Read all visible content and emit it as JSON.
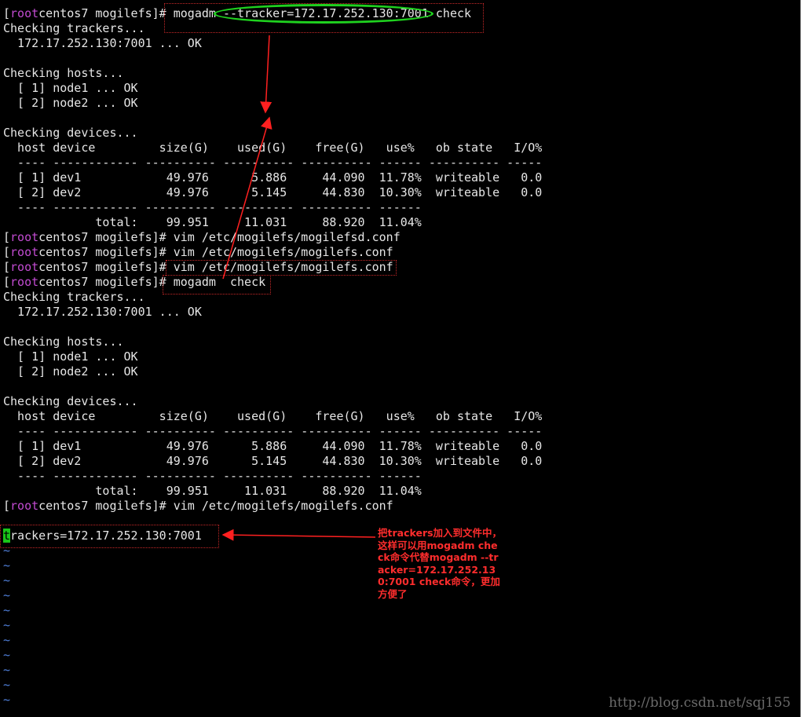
{
  "terminal": {
    "prompt": {
      "open": "[",
      "user": "root",
      "rest": "centos7 mogilefs]# "
    },
    "lines": {
      "l0_cmd": "mogadm --tracker=172.17.252.130:7001 check",
      "l1": "Checking trackers...",
      "l2": "  172.17.252.130:7001 ... OK",
      "l4": "Checking hosts...",
      "l5": "  [ 1] node1 ... OK",
      "l6": "  [ 2] node2 ... OK",
      "l8": "Checking devices...",
      "l9": "  host device         size(G)    used(G)    free(G)   use%   ob state   I/O%",
      "l10": "  ---- ------------ ---------- ---------- ---------- ------ ---------- -----",
      "l11": "  [ 1] dev1            49.976      5.886     44.090  11.78%  writeable   0.0",
      "l12": "  [ 2] dev2            49.976      5.145     44.830  10.30%  writeable   0.0",
      "l13": "  ---- ------------ ---------- ---------- ---------- ------",
      "l14": "             total:    99.951     11.031     88.920  11.04%",
      "l15_cmd": "vim /etc/mogilefs/mogilefsd.conf",
      "l16_cmd": "vim /etc/mogilefs/mogilefs.conf",
      "l17_cmd": "vim /etc/mogilefs/mogilefs.conf",
      "l18_cmd": "mogadm  check",
      "l19": "Checking trackers...",
      "l20": "  172.17.252.130:7001 ... OK",
      "l22": "Checking hosts...",
      "l23": "  [ 1] node1 ... OK",
      "l24": "  [ 2] node2 ... OK",
      "l26": "Checking devices...",
      "l27": "  host device         size(G)    used(G)    free(G)   use%   ob state   I/O%",
      "l28": "  ---- ------------ ---------- ---------- ---------- ------ ---------- -----",
      "l29": "  [ 1] dev1            49.976      5.886     44.090  11.78%  writeable   0.0",
      "l30": "  [ 2] dev2            49.976      5.145     44.830  10.30%  writeable   0.0",
      "l31": "  ---- ------------ ---------- ---------- ---------- ------",
      "l32": "             total:    99.951     11.031     88.920  11.04%",
      "l33_cmd": "vim /etc/mogilefs/mogilefs.conf",
      "l35_cursor": "t",
      "l35_rest": "rackers=172.17.252.130:7001",
      "tilde": "~"
    }
  },
  "annotation": {
    "text": "把trackers加入到文件中，这样可以用mogadm check命令代替mogadm --tracker=172.17.252.130:7001 check命令，更加方便了"
  },
  "watermark": "http://blog.csdn.net/sqj155",
  "colors": {
    "background": "#000000",
    "text": "#e6e6e6",
    "prompt_user": "#c24bd1",
    "cursor": "#19c519",
    "tilde": "#4f7fd9",
    "annotation": "#ff2d2d",
    "highlight_oval": "#1fd21f"
  }
}
